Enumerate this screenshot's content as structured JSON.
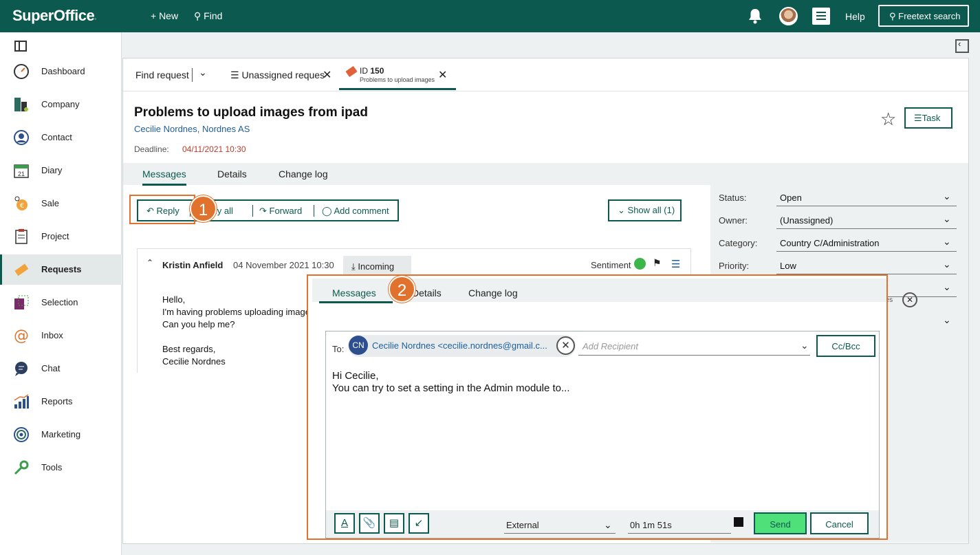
{
  "topbar": {
    "logo": "SuperOffice",
    "new_label": "+ New",
    "find_label": "Find",
    "help_label": "Help",
    "search_label": "Freetext search"
  },
  "sidebar": {
    "items": [
      {
        "label": "Dashboard",
        "icon": "dashboard-icon"
      },
      {
        "label": "Company",
        "icon": "company-icon"
      },
      {
        "label": "Contact",
        "icon": "contact-icon"
      },
      {
        "label": "Diary",
        "icon": "diary-icon",
        "badge": "21"
      },
      {
        "label": "Sale",
        "icon": "sale-icon"
      },
      {
        "label": "Project",
        "icon": "project-icon"
      },
      {
        "label": "Requests",
        "icon": "requests-icon",
        "active": true
      },
      {
        "label": "Selection",
        "icon": "selection-icon"
      },
      {
        "label": "Inbox",
        "icon": "inbox-icon"
      },
      {
        "label": "Chat",
        "icon": "chat-icon"
      },
      {
        "label": "Reports",
        "icon": "reports-icon"
      },
      {
        "label": "Marketing",
        "icon": "marketing-icon"
      },
      {
        "label": "Tools",
        "icon": "tools-icon"
      }
    ]
  },
  "tabs": {
    "find": "Find request",
    "unassigned": "Unassigned reques",
    "id_prefix": "ID",
    "id_number": "150",
    "id_subtitle": "Problems to upload images"
  },
  "request": {
    "title": "Problems to upload images from ipad",
    "contact": "Cecilie Nordnes, Nordnes AS",
    "deadline_label": "Deadline:",
    "deadline": "04/11/2021 10:30",
    "task_label": "Task"
  },
  "subtabs": [
    "Messages",
    "Details",
    "Change log"
  ],
  "actions": {
    "reply": "Reply",
    "reply_all": "Reply all",
    "forward": "Forward",
    "add_comment": "Add comment",
    "show_all": "Show all (1)"
  },
  "message": {
    "author": "Kristin Anfield",
    "date": "04 November 2021 10:30",
    "direction": "Incoming",
    "sentiment_label": "Sentiment",
    "body": "Hello,\nI'm having problems uploading images\nCan you help me?\n\nBest regards,\nCecilie Nordnes"
  },
  "details_panel": {
    "fields": [
      {
        "label": "Status:",
        "value": "Open"
      },
      {
        "label": "Owner:",
        "value": "(Unassigned)"
      },
      {
        "label": "Category:",
        "value": "Country C/Administration"
      },
      {
        "label": "Priority:",
        "value": "Low"
      }
    ],
    "partial_tag": "sues"
  },
  "callouts": {
    "one": "1",
    "two": "2"
  },
  "popup": {
    "tabs": [
      "Messages",
      "Details",
      "Change log"
    ],
    "to_label": "To:",
    "recipient_initials": "CN",
    "recipient": "Cecilie Nordnes <cecilie.nordnes@gmail.c...",
    "add_recipient_placeholder": "Add Recipient",
    "ccbcc": "Cc/Bcc",
    "body": "Hi Cecilie,\nYou can try to set a setting in the Admin module to...",
    "visibility": "External",
    "timer": "0h 1m 51s",
    "send": "Send",
    "cancel": "Cancel"
  },
  "colors": {
    "brand": "#0c5a4f",
    "highlight": "#e0722e",
    "send": "#4fe07a",
    "deadline": "#c0392b",
    "link": "#1f5e9c"
  }
}
